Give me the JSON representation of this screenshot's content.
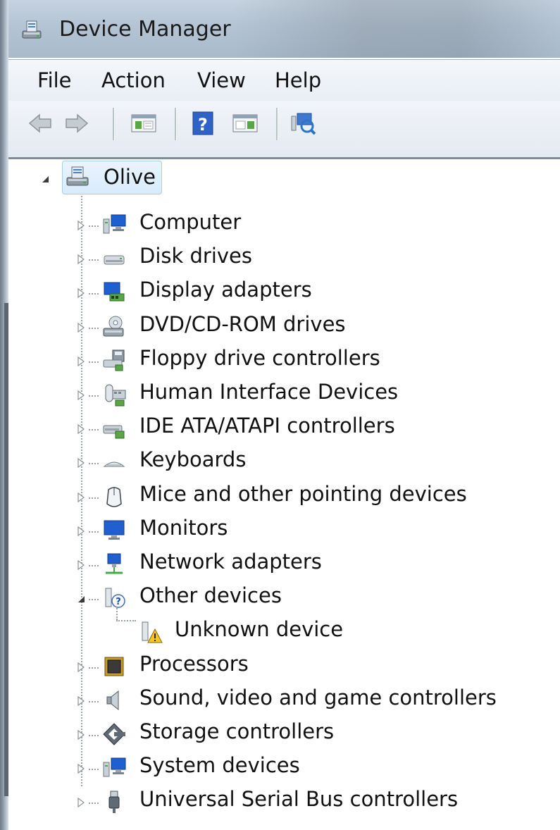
{
  "window": {
    "title": "Device Manager",
    "icon": "device-manager-icon"
  },
  "menu": {
    "items": [
      "File",
      "Action",
      "View",
      "Help"
    ]
  },
  "toolbar": {
    "buttons": [
      "back-arrow-icon",
      "forward-arrow-icon",
      "show-hide-console-tree-icon",
      "help-icon",
      "show-hide-action-pane-icon",
      "scan-hardware-icon"
    ]
  },
  "tree": {
    "root": {
      "label": "Olive",
      "icon": "computer-printer-icon",
      "expanded": true
    },
    "categories": [
      {
        "label": "Computer",
        "icon": "computer-icon",
        "expanded": false
      },
      {
        "label": "Disk drives",
        "icon": "disk-drive-icon",
        "expanded": false
      },
      {
        "label": "Display adapters",
        "icon": "display-adapter-icon",
        "expanded": false
      },
      {
        "label": "DVD/CD-ROM drives",
        "icon": "dvd-drive-icon",
        "expanded": false
      },
      {
        "label": "Floppy drive controllers",
        "icon": "floppy-controller-icon",
        "expanded": false
      },
      {
        "label": "Human Interface Devices",
        "icon": "hid-icon",
        "expanded": false
      },
      {
        "label": "IDE ATA/ATAPI controllers",
        "icon": "ide-controller-icon",
        "expanded": false
      },
      {
        "label": "Keyboards",
        "icon": "keyboard-icon",
        "expanded": false
      },
      {
        "label": "Mice and other pointing devices",
        "icon": "mouse-icon",
        "expanded": false
      },
      {
        "label": "Monitors",
        "icon": "monitor-icon",
        "expanded": false
      },
      {
        "label": "Network adapters",
        "icon": "network-adapter-icon",
        "expanded": false
      },
      {
        "label": "Other devices",
        "icon": "unknown-device-category-icon",
        "expanded": true
      },
      {
        "label": "Unknown device",
        "icon": "warning-device-icon",
        "child": true
      },
      {
        "label": "Processors",
        "icon": "processor-icon",
        "expanded": false
      },
      {
        "label": "Sound, video and game controllers",
        "icon": "speaker-icon",
        "expanded": false
      },
      {
        "label": "Storage controllers",
        "icon": "storage-controller-icon",
        "expanded": false
      },
      {
        "label": "System devices",
        "icon": "system-devices-icon",
        "expanded": false
      },
      {
        "label": "Universal Serial Bus controllers",
        "icon": "usb-icon",
        "expanded": false
      }
    ]
  }
}
